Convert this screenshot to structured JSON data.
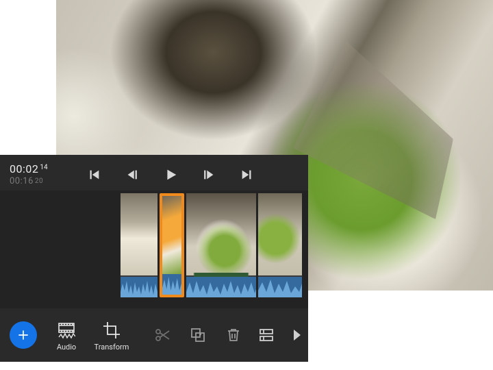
{
  "timecodes": {
    "playhead": "00:02",
    "playhead_frames": "14",
    "duration": "00:16",
    "duration_frames": "20"
  },
  "transport": {
    "go_start": "go-to-start",
    "step_back": "step-back",
    "play": "play",
    "step_fwd": "step-forward",
    "go_end": "go-to-end"
  },
  "timeline": {
    "clips": [
      {
        "id": "clip-1",
        "selected": false
      },
      {
        "id": "clip-2",
        "selected": true
      },
      {
        "id": "clip-3",
        "selected": false
      },
      {
        "id": "clip-4",
        "selected": false
      }
    ]
  },
  "bottom": {
    "add_label": "Add",
    "audio_label": "Audio",
    "transform_label": "Transform",
    "cut": "split-clip",
    "duplicate": "duplicate-clip",
    "delete": "delete-clip",
    "more_panels": "more-panels",
    "next": "next-panel"
  },
  "colors": {
    "accent": "#1473e6",
    "selection": "#f08a1d",
    "audio": "#356a9e",
    "panel": "#2a2a2a"
  }
}
